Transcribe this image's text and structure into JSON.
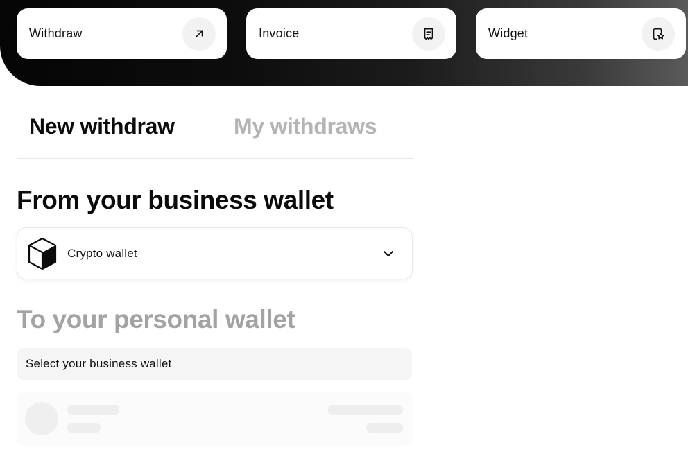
{
  "actions": [
    {
      "label": "Withdraw",
      "icon": "arrow-up-right-icon"
    },
    {
      "label": "Invoice",
      "icon": "receipt-icon"
    },
    {
      "label": "Widget",
      "icon": "widget-star-icon"
    }
  ],
  "tabs": {
    "active": "New withdraw",
    "inactive": "My withdraws"
  },
  "from_section": {
    "title": "From your business wallet",
    "wallet_label": "Crypto wallet",
    "wallet_icon": "cube-icon",
    "dropdown_icon": "chevron-down-icon"
  },
  "to_section": {
    "title": "To your personal wallet",
    "prompt": "Select your business wallet"
  },
  "colors": {
    "active_text": "#0b0b0b",
    "inactive_text": "#b4b4b4",
    "muted_title": "#a3a3a3"
  }
}
